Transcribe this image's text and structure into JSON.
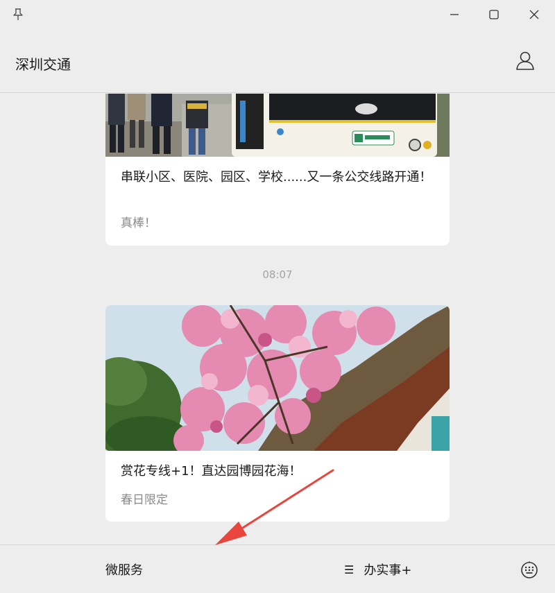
{
  "window": {
    "pin_icon": "pin-icon",
    "min_icon": "minimize-icon",
    "max_icon": "maximize-icon",
    "close_icon": "close-icon"
  },
  "header": {
    "title": "深圳交通",
    "profile_icon": "user-profile-icon"
  },
  "feed": {
    "articles": [
      {
        "title": "串联小区、医院、园区、学校......又一条公交线路开通！",
        "subtitle": "真棒！",
        "image": "bus-photo"
      },
      {
        "title": "赏花专线+1！直达园博园花海！",
        "subtitle": "春日限定",
        "image": "flowers-photo"
      }
    ],
    "timestamp": "08:07"
  },
  "bottom_menu": {
    "micro_service": "微服务",
    "office_plus": "办实事+",
    "office_icon": "menu-list-icon",
    "keyboard_icon": "keyboard-icon"
  },
  "annotation": {
    "arrow_color": "#e8453c"
  }
}
